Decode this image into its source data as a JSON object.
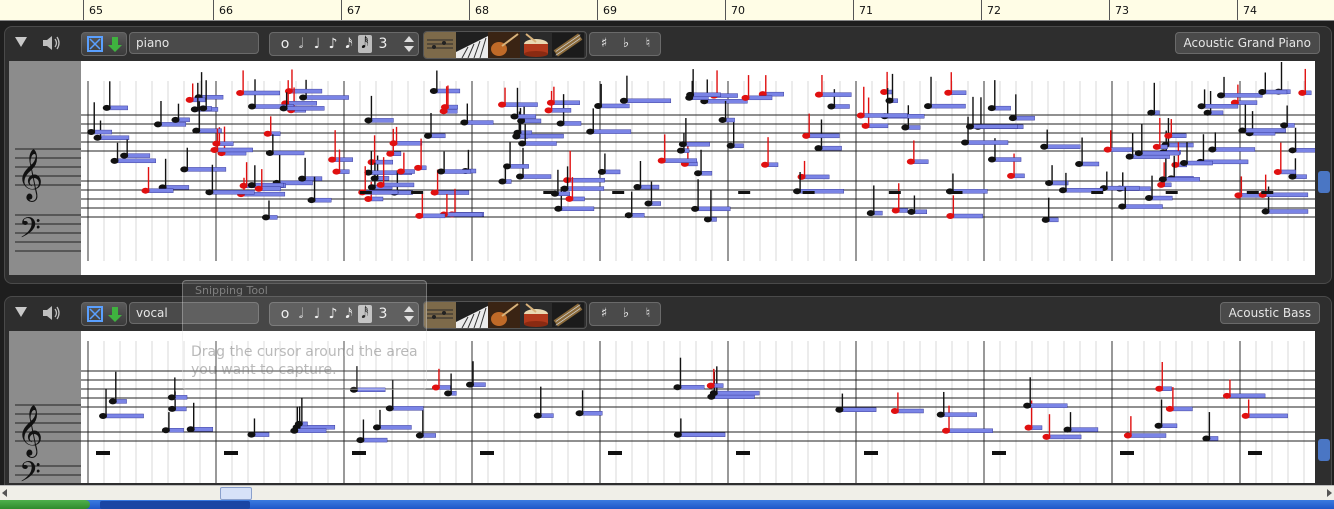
{
  "ruler": {
    "measures": [
      "65",
      "66",
      "67",
      "68",
      "69",
      "70",
      "71",
      "72",
      "73",
      "74"
    ]
  },
  "tracks": [
    {
      "name": "piano",
      "instrument": "Acoustic Grand Piano",
      "durations": [
        "o",
        "𝅗𝅥",
        "♩",
        "♪",
        "𝅘𝅥𝅯",
        "𝅘𝅥𝅰",
        "3"
      ],
      "accidentals": [
        "♯",
        "♭",
        "♮"
      ]
    },
    {
      "name": "vocal",
      "instrument": "Acoustic Bass",
      "durations": [
        "o",
        "𝅗𝅥",
        "♩",
        "♪",
        "𝅘𝅥𝅯",
        "𝅘𝅥𝅰",
        "3"
      ],
      "accidentals": [
        "♯",
        "♭",
        "♮"
      ]
    }
  ],
  "capture_window": {
    "title": "Snipping Tool",
    "message": "Drag the cursor around the area you want to capture."
  },
  "icons": {
    "collapse": "triangle-down-icon",
    "speaker": "speaker-icon",
    "import": "import-arrow-icon",
    "instruments": [
      "score-icon",
      "keyboard-icon",
      "guitar-icon",
      "drum-icon",
      "guitar-neck-icon"
    ]
  },
  "colors": {
    "note_fill": "#7a84e6",
    "note_red": "#e01010",
    "panel": "#2e2e2e",
    "clef_bg": "#8c8c8c"
  }
}
